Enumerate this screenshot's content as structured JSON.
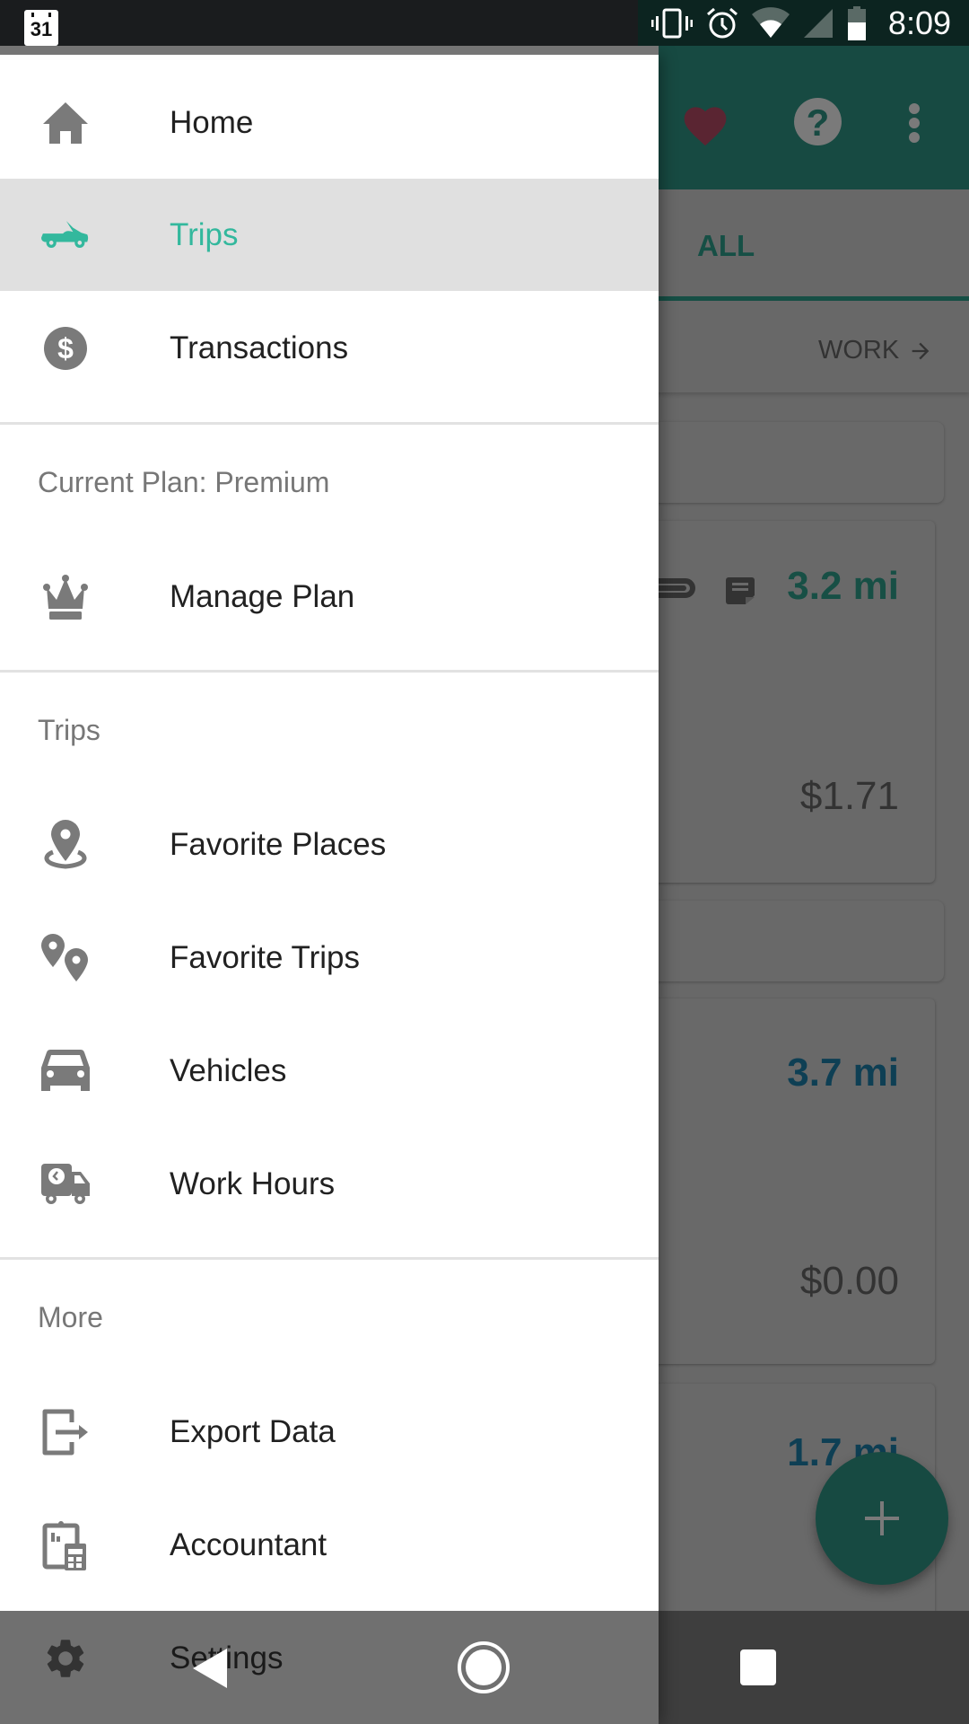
{
  "status_bar": {
    "notification_icon": "calendar-icon",
    "calendar_day": "31",
    "icons": [
      "vibrate-icon",
      "alarm-icon",
      "wifi-icon",
      "cellular-signal-icon",
      "battery-icon"
    ],
    "time": "8:09"
  },
  "background_app": {
    "toolbar": {
      "actions": [
        "heart-icon",
        "help-icon",
        "more-vert-icon"
      ]
    },
    "tabs": {
      "active_tab": "ALL"
    },
    "filter_link": {
      "label": "WORK",
      "icon": "arrow-right-icon"
    },
    "trips": [
      {
        "distance": "3.2 mi",
        "amount": "$1.71",
        "distance_color": "#17a38a",
        "icons": [
          "link-icon",
          "note-icon"
        ]
      },
      {
        "distance": "3.7 mi",
        "amount": "$0.00",
        "distance_color": "#1a6e94",
        "icons": []
      },
      {
        "distance": "1.7 mi",
        "amount": "",
        "distance_color": "#1a6e94",
        "icons": []
      }
    ],
    "fab": {
      "icon": "plus-icon"
    }
  },
  "drawer": {
    "primary_items": [
      {
        "label": "Home",
        "icon": "home-icon",
        "active": false
      },
      {
        "label": "Trips",
        "icon": "car-convertible-icon",
        "active": true
      },
      {
        "label": "Transactions",
        "icon": "dollar-circle-icon",
        "active": false
      }
    ],
    "plan_section": {
      "header": "Current Plan: Premium",
      "items": [
        {
          "label": "Manage Plan",
          "icon": "crown-icon"
        }
      ]
    },
    "trips_section": {
      "header": "Trips",
      "items": [
        {
          "label": "Favorite Places",
          "icon": "place-pin-icon"
        },
        {
          "label": "Favorite Trips",
          "icon": "two-pins-icon"
        },
        {
          "label": "Vehicles",
          "icon": "car-icon"
        },
        {
          "label": "Work Hours",
          "icon": "truck-clock-icon"
        }
      ]
    },
    "more_section": {
      "header": "More",
      "items": [
        {
          "label": "Export Data",
          "icon": "export-icon"
        },
        {
          "label": "Accountant",
          "icon": "accountant-icon"
        },
        {
          "label": "Settings",
          "icon": "gear-icon"
        }
      ]
    }
  },
  "nav_bar": {
    "buttons": [
      "back-icon",
      "home-circle-icon",
      "recents-icon"
    ]
  },
  "colors": {
    "accent": "#33b89d",
    "toolbar_dimmed": "#174a42",
    "drawer_bg": "#ffffff",
    "active_item_bg": "#e0e0e0"
  }
}
